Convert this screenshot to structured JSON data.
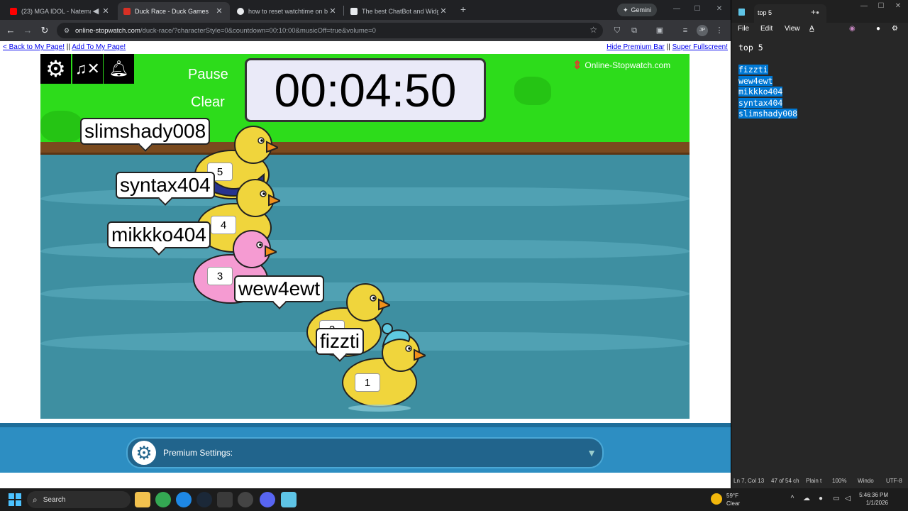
{
  "browser": {
    "tabs": [
      {
        "title": "(23) MGA IDOL - Nateman",
        "color": "#ff0000",
        "active": false
      },
      {
        "title": "Duck Race - Duck Games",
        "color": "#d93025",
        "active": true
      },
      {
        "title": "how to reset watchtime on bot",
        "color": "#e8eaed",
        "active": false
      },
      {
        "title": "The best ChatBot and Widgets",
        "color": "#e8eaed",
        "active": false
      }
    ],
    "new_tab_label": "+",
    "gemini_label": "Gemini",
    "url_host": "online-stopwatch.com",
    "url_path": "/duck-race/?characterStyle=0&countdown=00:10:00&musicOff=true&volume=0",
    "profile_initials": "JP"
  },
  "page": {
    "back_link": "< Back to My Page!",
    "separator": "||",
    "add_link": "Add To My Page!",
    "hide_premium_link": "Hide Premium Bar",
    "fullscreen_link": "Super Fullscreen!",
    "pause_label": "Pause",
    "clear_label": "Clear",
    "timer": "00:04:50",
    "logo_text": "Online-Stopwatch.com",
    "premium_label": "Premium Settings:"
  },
  "ducks": [
    {
      "name": "slimshady008",
      "number": "5",
      "body": "#f0d53c",
      "outfit": "suit"
    },
    {
      "name": "syntax404",
      "number": "4",
      "body": "#f0d53c",
      "outfit": "none"
    },
    {
      "name": "mikkko404",
      "number": "3",
      "body": "#f59bd2",
      "outfit": "none"
    },
    {
      "name": "wew4ewt",
      "number": "2",
      "body": "#f0d53c",
      "outfit": "none"
    },
    {
      "name": "fizzti",
      "number": "1",
      "body": "#f0d53c",
      "outfit": "beanie"
    }
  ],
  "notepad": {
    "tab_title": "top 5",
    "menu": [
      "File",
      "Edit",
      "View"
    ],
    "title_line": "top 5",
    "lines": [
      "fizzti",
      "wew4ewt",
      "mikkko404",
      "syntax404",
      "slimshady008"
    ],
    "status": {
      "position": "Ln 7, Col 13",
      "chars": "47 of 54 ch",
      "format": "Plain t",
      "zoom": "100%",
      "eol": "Windo",
      "encoding": "UTF-8"
    }
  },
  "taskbar": {
    "search_label": "Search",
    "weather_temp": "59°F",
    "weather_desc": "Clear",
    "time": "5:46:36 PM",
    "date": "1/1/2026"
  }
}
